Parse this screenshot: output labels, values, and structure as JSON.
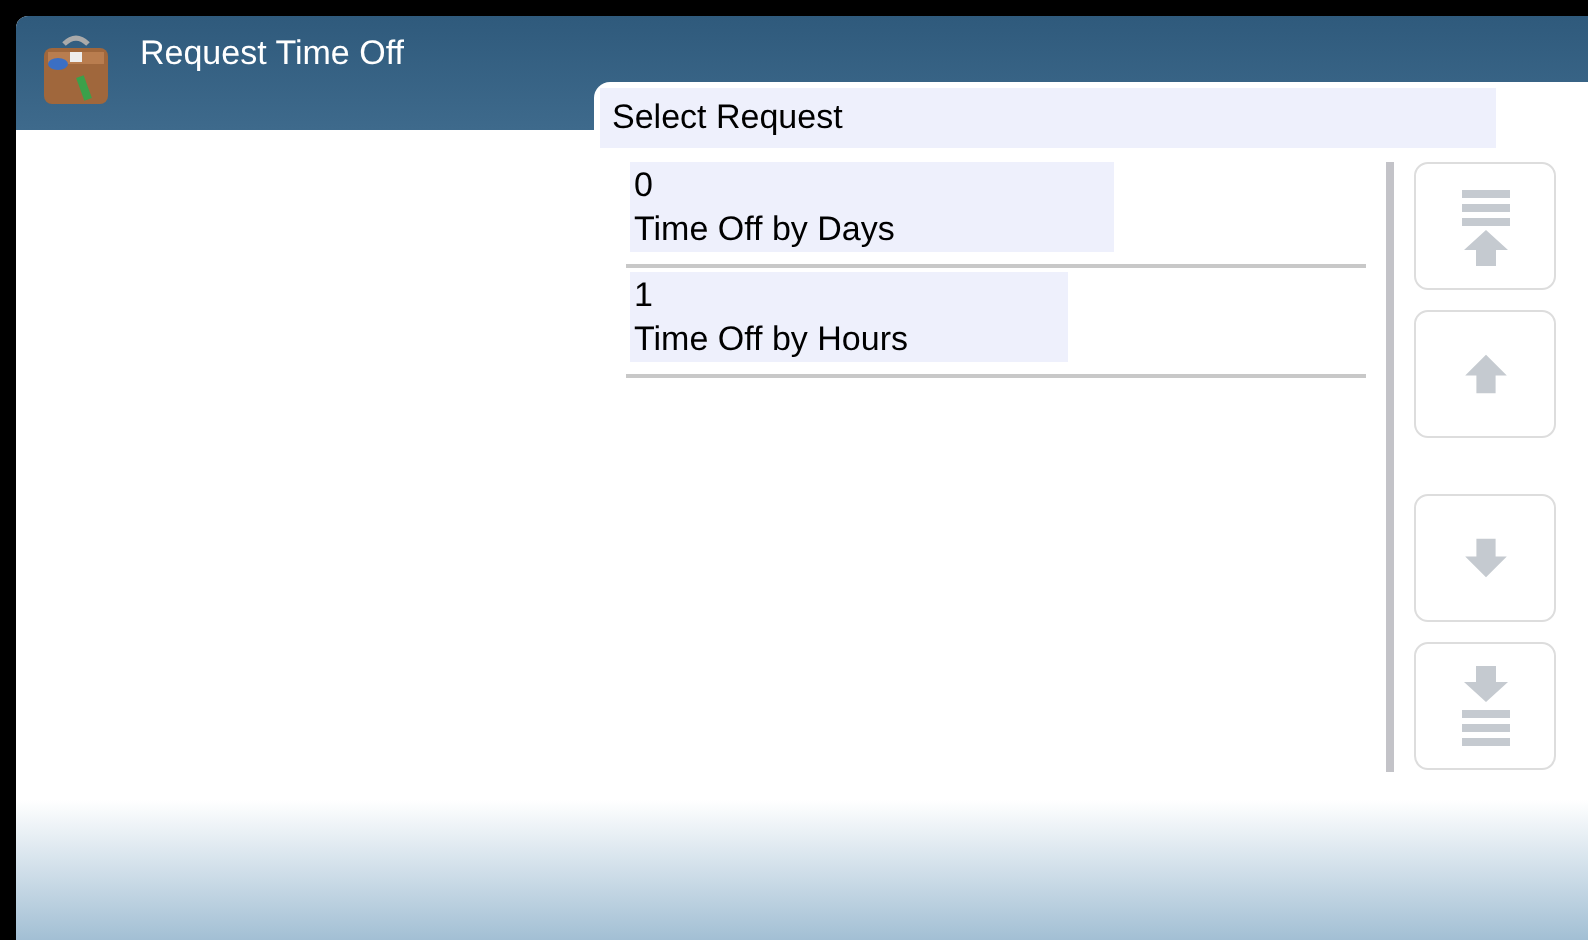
{
  "window": {
    "title": "Request Time Off"
  },
  "panel": {
    "title": "Select Request"
  },
  "requests": [
    {
      "number": "0",
      "label": "Time Off by Days"
    },
    {
      "number": "1",
      "label": "Time Off by Hours"
    }
  ],
  "scroll_buttons": [
    {
      "kind": "top",
      "disabled": true
    },
    {
      "kind": "up",
      "disabled": true
    },
    {
      "kind": "down",
      "disabled": true
    },
    {
      "kind": "bottom",
      "disabled": true
    }
  ]
}
